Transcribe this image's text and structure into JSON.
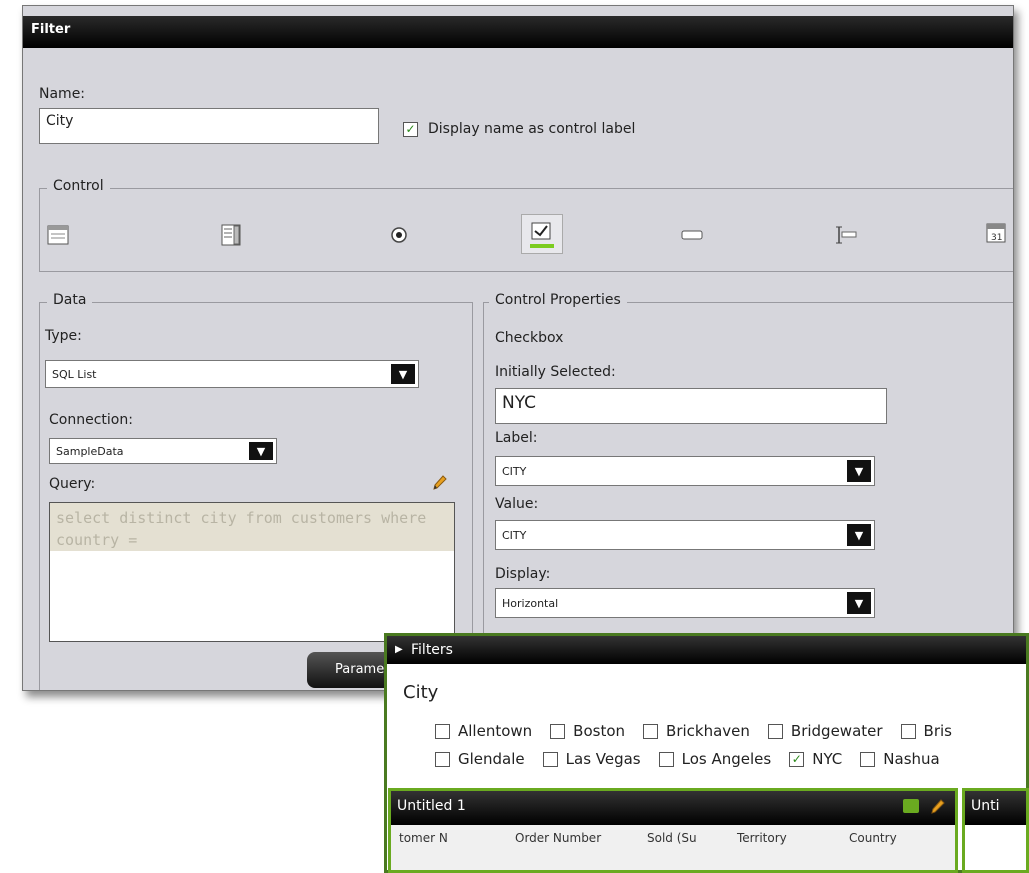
{
  "dialog": {
    "title": "Filter",
    "name_label": "Name:",
    "name_value": "City",
    "display_name_checkbox": {
      "label": "Display name as control label",
      "checked": true
    },
    "control_section": "Control",
    "control_icons": [
      "list-box-icon",
      "multi-list-icon",
      "radio-button-icon",
      "checkbox-icon",
      "textbox-icon",
      "slider-icon",
      "date-picker-icon"
    ],
    "data_section": "Data",
    "type_label": "Type:",
    "type_value": "SQL List",
    "connection_label": "Connection:",
    "connection_value": "SampleData",
    "query_label": "Query:",
    "query_text": "select distinct city from customers where country =",
    "param_button": "Parame",
    "control_properties_section": "Control Properties",
    "control_type": "Checkbox",
    "initially_selected_label": "Initially Selected:",
    "initially_selected_value": "NYC",
    "label_label": "Label:",
    "label_value": "CITY",
    "value_label": "Value:",
    "value_value": "CITY",
    "display_label": "Display:",
    "display_value": "Horizontal"
  },
  "filters_panel": {
    "title": "Filters",
    "group_label": "City",
    "row1": [
      "Allentown",
      "Boston",
      "Brickhaven",
      "Bridgewater",
      "Bris"
    ],
    "row2": [
      "Glendale",
      "Las Vegas",
      "Los Angeles",
      "NYC",
      "Nashua"
    ],
    "checked": [
      "NYC"
    ]
  },
  "untitled_panel": {
    "title": "Untitled 1",
    "columns": [
      "tomer N",
      "Order Number",
      "Sold (Su",
      "Territory",
      "Country"
    ]
  },
  "untitled_panel_2": {
    "title": "Unti"
  },
  "colors": {
    "accent_green": "#6aaa20",
    "titlebar": "#000000",
    "dialog_bg": "#d6d6dc"
  }
}
